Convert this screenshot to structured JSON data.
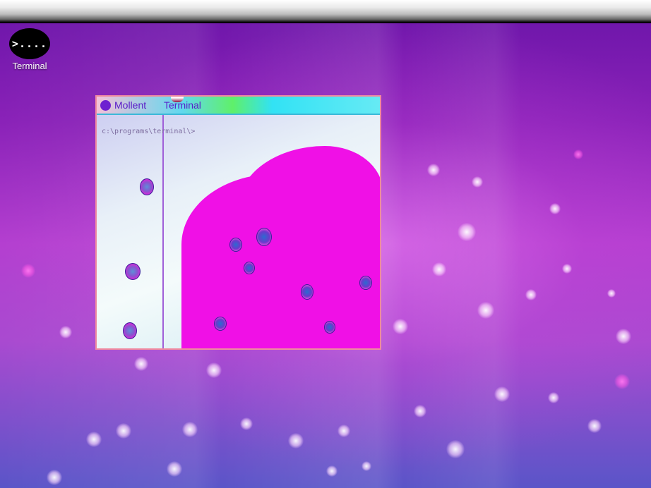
{
  "desktop": {
    "shortcut": {
      "icon_glyph": ">....",
      "label": "Terminal"
    }
  },
  "window": {
    "title_left": "Mollent",
    "title_right": "Terminal",
    "prompt": "c:\\programs\\terminal\\>"
  },
  "colors": {
    "top_bar": "#e0e0e0",
    "title_bar": "#4ee0f0",
    "title_text": "#5a1cc8",
    "wallpaper_main": "#b43fd0",
    "window_border": "#f08aa0"
  }
}
